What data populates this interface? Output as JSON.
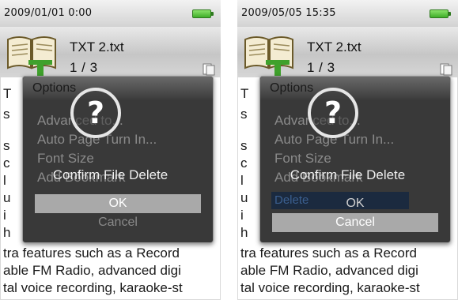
{
  "panels": [
    {
      "datetime": "2009/01/01  0:00",
      "filename": "TXT 2.txt",
      "page": "1 / 3",
      "options_title": "Options",
      "menu": [
        "Advanced to...",
        "Auto Page Turn In...",
        "Font Size",
        "Add Bookmark"
      ],
      "confirm": "Confirm File Delete",
      "ok": "OK",
      "cancel": "Cancel",
      "selected": "ok",
      "text_lines": [
        "T",
        "s",
        "s",
        "c",
        "l",
        "u",
        "i",
        "h",
        "tra features such as a Record",
        "able FM Radio, advanced digi",
        "tal voice recording, karaoke-st"
      ]
    },
    {
      "datetime": "2009/05/05  15:35",
      "filename": "TXT 2.txt",
      "page": "1 / 3",
      "options_title": "Options",
      "menu": [
        "Advanced to...",
        "Auto Page Turn In...",
        "Font Size",
        "Add Bookmark"
      ],
      "delete_label": "Delete",
      "confirm": "Confirm File Delete",
      "ok": "OK",
      "cancel": "Cancel",
      "selected": "cancel",
      "text_lines": [
        "T",
        "s",
        "s",
        "c",
        "l",
        "u",
        "i",
        "h",
        "tra features such as a Record",
        "able FM Radio, advanced digi",
        "tal voice recording, karaoke-st"
      ]
    }
  ],
  "colors": {
    "battery": "#3fae29",
    "selected_button": "#a9a9a9",
    "dialog_bg": "#282828",
    "delete_highlight": "#1b2a3f"
  },
  "icons": [
    "book-icon",
    "question-icon",
    "document-icon",
    "battery-icon"
  ]
}
